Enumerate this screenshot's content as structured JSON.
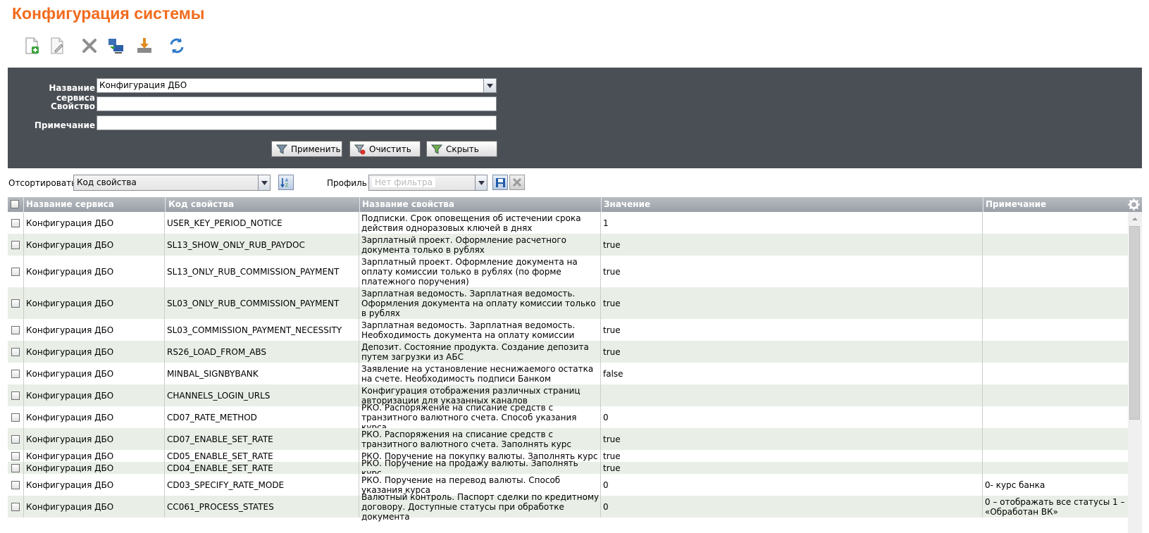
{
  "page": {
    "title": "Конфигурация системы"
  },
  "toolbar": {
    "icons": [
      "new-document-icon",
      "edit-document-icon",
      "delete-icon",
      "export-to-computer-icon",
      "import-download-icon",
      "refresh-icon"
    ]
  },
  "filter": {
    "service_label": "Название сервиса",
    "service_value": "Конфигурация ДБО",
    "property_label": "Свойство",
    "property_value": "",
    "note_label": "Примечание",
    "note_value": "",
    "apply_label": "Применить",
    "clear_label": "Очистить",
    "hide_label": "Скрыть"
  },
  "sort": {
    "label": "Отсортировать",
    "value": "Код свойства",
    "profile_label": "Профиль",
    "profile_placeholder": "Нет фильтра"
  },
  "colors": {
    "title": "#f26b1d",
    "panel": "#4a4f55",
    "row_alt": "#e9efe7"
  },
  "grid": {
    "headers": {
      "service": "Название сервиса",
      "code": "Код свойства",
      "name": "Название свойства",
      "value": "Значение",
      "note": "Примечание"
    },
    "rows": [
      {
        "service": "Конфигурация ДБО",
        "code": "USER_KEY_PERIOD_NOTICE",
        "name": "Подписки. Срок оповещения об истечении срока действия одноразовых ключей в днях",
        "value": "1",
        "note": ""
      },
      {
        "service": "Конфигурация ДБО",
        "code": "SL13_SHOW_ONLY_RUB_PAYDOC",
        "name": "Зарплатный проект. Оформление расчетного документа только в рублях",
        "value": "true",
        "note": ""
      },
      {
        "service": "Конфигурация ДБО",
        "code": "SL13_ONLY_RUB_COMMISSION_PAYMENT",
        "name": "Зарплатный проект. Оформление документа на оплату комиссии только в рублях (по форме платежного поручения)",
        "value": "true",
        "note": ""
      },
      {
        "service": "Конфигурация ДБО",
        "code": "SL03_ONLY_RUB_COMMISSION_PAYMENT",
        "name": "Зарплатная ведомость. Зарплатная ведомость. Оформления документа на оплату комиссии только в рублях",
        "value": "true",
        "note": ""
      },
      {
        "service": "Конфигурация ДБО",
        "code": "SL03_COMMISSION_PAYMENT_NECESSITY",
        "name": "Зарплатная ведомость. Зарплатная ведомость. Необходимость документа на оплату комиссии",
        "value": "true",
        "note": ""
      },
      {
        "service": "Конфигурация ДБО",
        "code": "RS26_LOAD_FROM_ABS",
        "name": "Депозит. Состояние продукта. Создание депозита путем загрузки из АБС",
        "value": "true",
        "note": ""
      },
      {
        "service": "Конфигурация ДБО",
        "code": "MINBAL_SIGNBYBANK",
        "name": "Заявление на установление неснижаемого остатка на счете. Необходимость подписи Банком",
        "value": "false",
        "note": ""
      },
      {
        "service": "Конфигурация ДБО",
        "code": "CHANNELS_LOGIN_URLS",
        "name": "Конфигурация отображения различных страниц авторизации для указанных каналов",
        "value": "",
        "note": ""
      },
      {
        "service": "Конфигурация ДБО",
        "code": "CD07_RATE_METHOD",
        "name": "РКО. Распоряжение на списание средств с транзитного валютного счета. Способ указания курса.",
        "value": "0",
        "note": ""
      },
      {
        "service": "Конфигурация ДБО",
        "code": "CD07_ENABLE_SET_RATE",
        "name": "РКО. Распоряжения на списание средств с транзитного валютного счета. Заполнять курс",
        "value": "true",
        "note": ""
      },
      {
        "service": "Конфигурация ДБО",
        "code": "CD05_ENABLE_SET_RATE",
        "name": "РКО. Поручение на покупку валюты. Заполнять курс",
        "value": "true",
        "note": ""
      },
      {
        "service": "Конфигурация ДБО",
        "code": "CD04_ENABLE_SET_RATE",
        "name": "РКО. Поручение на продажу валюты. Заполнять курс",
        "value": "true",
        "note": ""
      },
      {
        "service": "Конфигурация ДБО",
        "code": "CD03_SPECIFY_RATE_MODE",
        "name": "РКО. Поручение на перевод валюты. Способ указания курса",
        "value": "0",
        "note": "0- курс банка"
      },
      {
        "service": "Конфигурация ДБО",
        "code": "CC061_PROCESS_STATES",
        "name": "Валютный контроль. Паспорт сделки по кредитному договору. Доступные статусы при обработке документа",
        "value": "0",
        "note": "0 – отображать все статусы 1 – «Обработан ВК»"
      }
    ]
  }
}
